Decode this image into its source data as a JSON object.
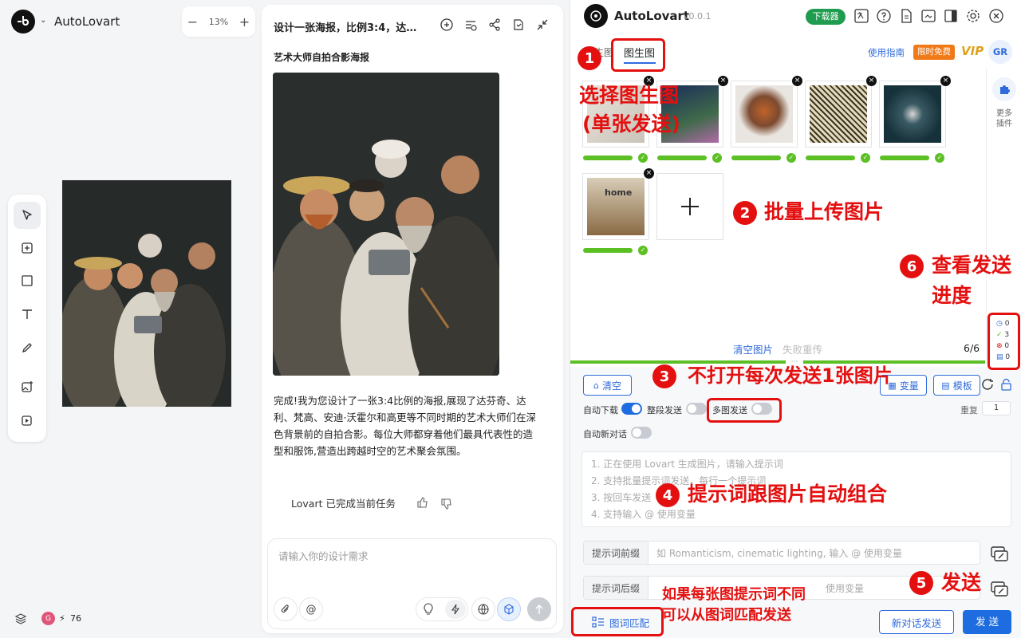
{
  "canvas": {
    "app_name": "AutoLovart",
    "zoom": "13%",
    "credits": "76",
    "avatar_initial": "G"
  },
  "chat": {
    "title": "设计一张海报，比例3:4，达…",
    "subtitle": "艺术大师自拍合影海报",
    "message": "完成!我为您设计了一张3:4比例的海报,展现了达芬奇、达利、梵高、安迪·沃霍尔和高更等不同时期的艺术大师们在深色背景前的自拍合影。每位大师都穿着他们最具代表性的造型和服饰,营造出跨越时空的艺术聚会氛围。",
    "status": "Lovart 已完成当前任务",
    "input_placeholder": "请输入你的设计需求"
  },
  "plugin": {
    "name": "AutoLovart",
    "version": "v0.0.1",
    "download_badge": "下载器",
    "tab_text_to_image": "图生图",
    "tab_hidden": "生图",
    "guide_link": "使用指南",
    "free_badge": "限时免费",
    "vip": "VIP",
    "user_initials": "GR",
    "more_plugins": "更多插件",
    "clear_images": "清空图片",
    "retry_failed": "失败重传",
    "progress": "6/6",
    "stats": {
      "pending": "0",
      "success": "3",
      "failed": "0",
      "docs": "0"
    },
    "buttons": {
      "clear": "清空",
      "variables": "变量",
      "template": "模板",
      "match": "图词匹配",
      "new_chat_send": "新对话发送",
      "send": "发 送"
    },
    "toggles": {
      "auto_download": "自动下载",
      "segment_send": "整段发送",
      "multi_image_send": "多图发送",
      "auto_new_chat": "自动新对话",
      "repeat": "重复",
      "repeat_value": "1"
    },
    "prompt_placeholder": [
      "1. 正在使用 Lovart 生成图片，请输入提示词",
      "2. 支持批量提示词发送，每行一个提示词",
      "3. 按回车发送",
      "4. 支持输入 @ 使用变量"
    ],
    "prefix_label": "提示词前缀",
    "prefix_placeholder": "如 Romanticism, cinematic lighting, 输入 @ 使用变量",
    "suffix_label": "提示词后缀",
    "suffix_placeholder": "使用变量",
    "image_names": [
      "home"
    ]
  },
  "annotations": {
    "a1": "选择图生图",
    "a1b": "(单张发送)",
    "a2": "批量上传图片",
    "a3": "不打开每次发送1张图片",
    "a4": "提示词跟图片自动组合",
    "a5": "发送",
    "a6a": "查看发送",
    "a6b": "进度",
    "a7a": "如果每张图提示词不同",
    "a7b": "可以从图词匹配发送",
    "n1": "1",
    "n2": "2",
    "n3": "3",
    "n4": "4",
    "n5": "5",
    "n6": "6"
  },
  "colors": {
    "accent": "#2f6bdc",
    "annotation": "#e41010",
    "success": "#5cc024",
    "badge_green": "#1f9c4f",
    "badge_orange": "#f07a18"
  }
}
